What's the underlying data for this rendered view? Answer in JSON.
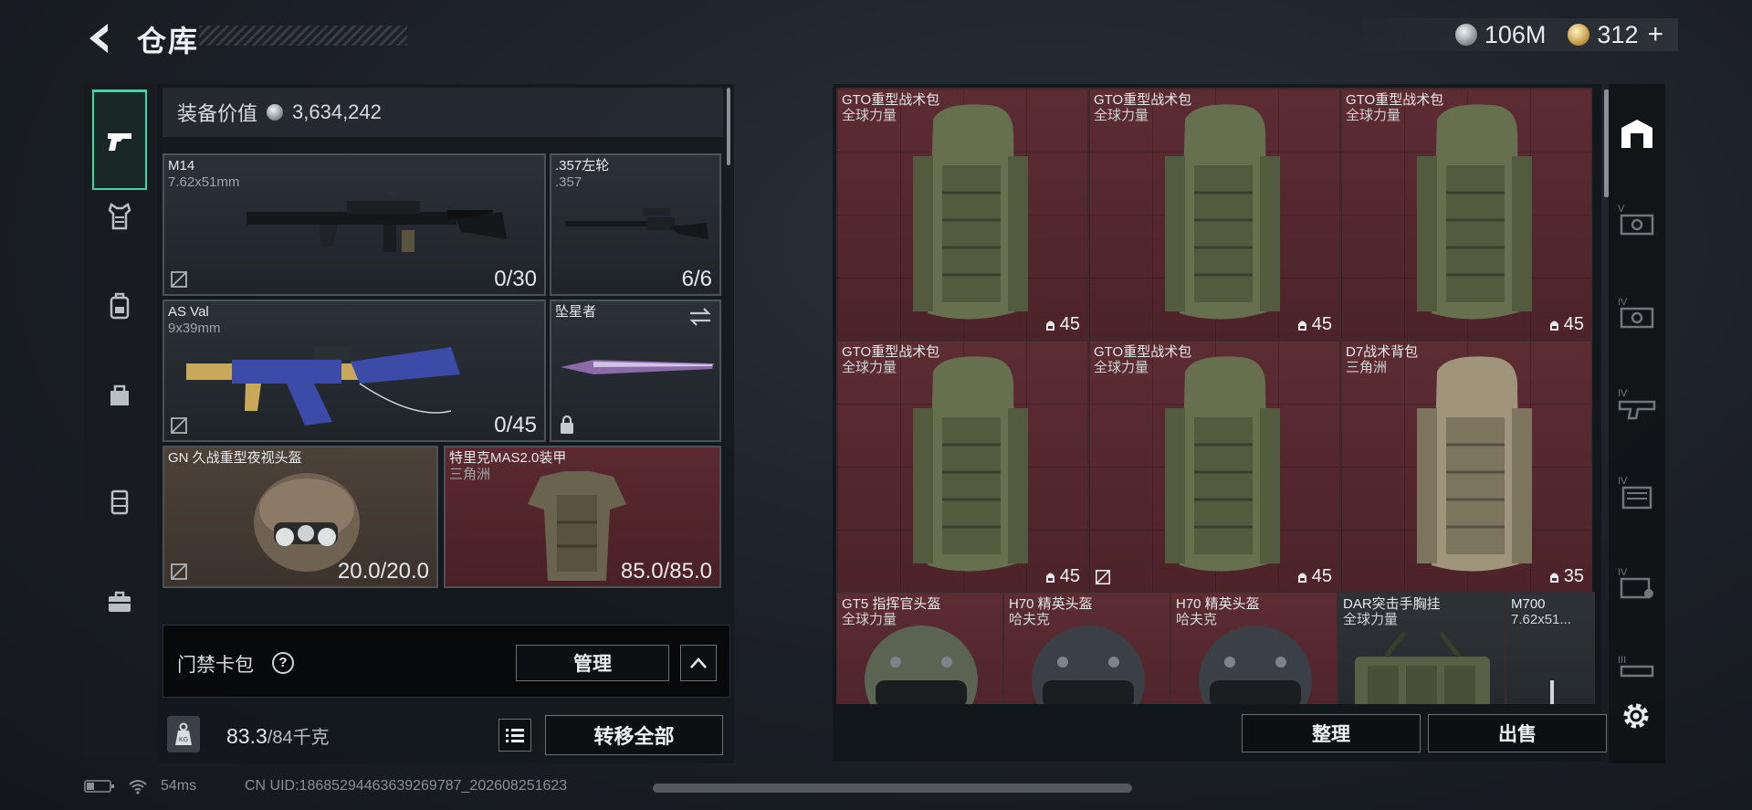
{
  "header": {
    "title": "仓库",
    "currencies": [
      {
        "icon": "silver-coin-icon",
        "value": "106M"
      },
      {
        "icon": "gold-coin-icon",
        "value": "312"
      }
    ],
    "add_label": "+"
  },
  "left_tabs": [
    {
      "icon": "pistol-icon",
      "active": true
    },
    {
      "icon": "armor-vest-icon",
      "active": false
    },
    {
      "icon": "backpack-icon",
      "active": false
    },
    {
      "icon": "pouch-icon",
      "active": false
    },
    {
      "icon": "chest-rig-icon",
      "active": false
    },
    {
      "icon": "briefcase-icon",
      "active": false
    }
  ],
  "loadout": {
    "value_label": "装备价值",
    "value": "3,634,242",
    "slots": [
      {
        "name": "M14",
        "sub": "7.62x51mm",
        "count": "0/30"
      },
      {
        "name": ".357左轮",
        "sub": ".357",
        "count": "6/6"
      },
      {
        "name": "AS Val",
        "sub": "9x39mm",
        "count": "0/45"
      },
      {
        "name": "坠星者",
        "sub": "",
        "count": ""
      },
      {
        "name": "GN 久战重型夜视头盔",
        "sub": "",
        "count": "20.0/20.0"
      },
      {
        "name": "特里克MAS2.0装甲",
        "sub": "三角洲",
        "count": "85.0/85.0"
      }
    ],
    "access_card": {
      "label": "门禁卡包",
      "help": "?",
      "manage": "管理"
    },
    "weight": {
      "current": "83.3",
      "max": "/84千克"
    },
    "transfer_all": "转移全部"
  },
  "stash": {
    "items": [
      {
        "name": "GTO重型战术包",
        "sub": "全球力量",
        "count": "45"
      },
      {
        "name": "GTO重型战术包",
        "sub": "全球力量",
        "count": "45"
      },
      {
        "name": "GTO重型战术包",
        "sub": "全球力量",
        "count": "45"
      },
      {
        "name": "GTO重型战术包",
        "sub": "全球力量",
        "count": "45"
      },
      {
        "name": "GTO重型战术包",
        "sub": "全球力量",
        "count": "45"
      },
      {
        "name": "D7战术背包",
        "sub": "三角洲",
        "count": "35"
      },
      {
        "name": "GT5 指挥官头盔",
        "sub": "全球力量",
        "count": ""
      },
      {
        "name": "H70 精英头盔",
        "sub": "哈夫克",
        "count": ""
      },
      {
        "name": "H70 精英头盔",
        "sub": "哈夫克",
        "count": ""
      },
      {
        "name": "DAR突击手胸挂",
        "sub": "全球力量",
        "count": ""
      },
      {
        "name": "M700",
        "sub": "7.62x51...",
        "count": ""
      }
    ],
    "sort_label": "整理",
    "sell_label": "出售"
  },
  "filter_tabs": [
    {
      "icon": "all-items-icon",
      "badge": ""
    },
    {
      "icon": "tier-v-icon",
      "badge": "V"
    },
    {
      "icon": "tier-iv-icon",
      "badge": "IV"
    },
    {
      "icon": "tier-iv-weapon-icon",
      "badge": "IV"
    },
    {
      "icon": "tier-iv-case-icon",
      "badge": "IV"
    },
    {
      "icon": "tier-iv-key-icon",
      "badge": "IV"
    },
    {
      "icon": "tier-iii-icon",
      "badge": "III"
    }
  ],
  "status_bar": {
    "ping": "54ms",
    "uid": "CN UID:18685294463639269787_202608251623"
  }
}
